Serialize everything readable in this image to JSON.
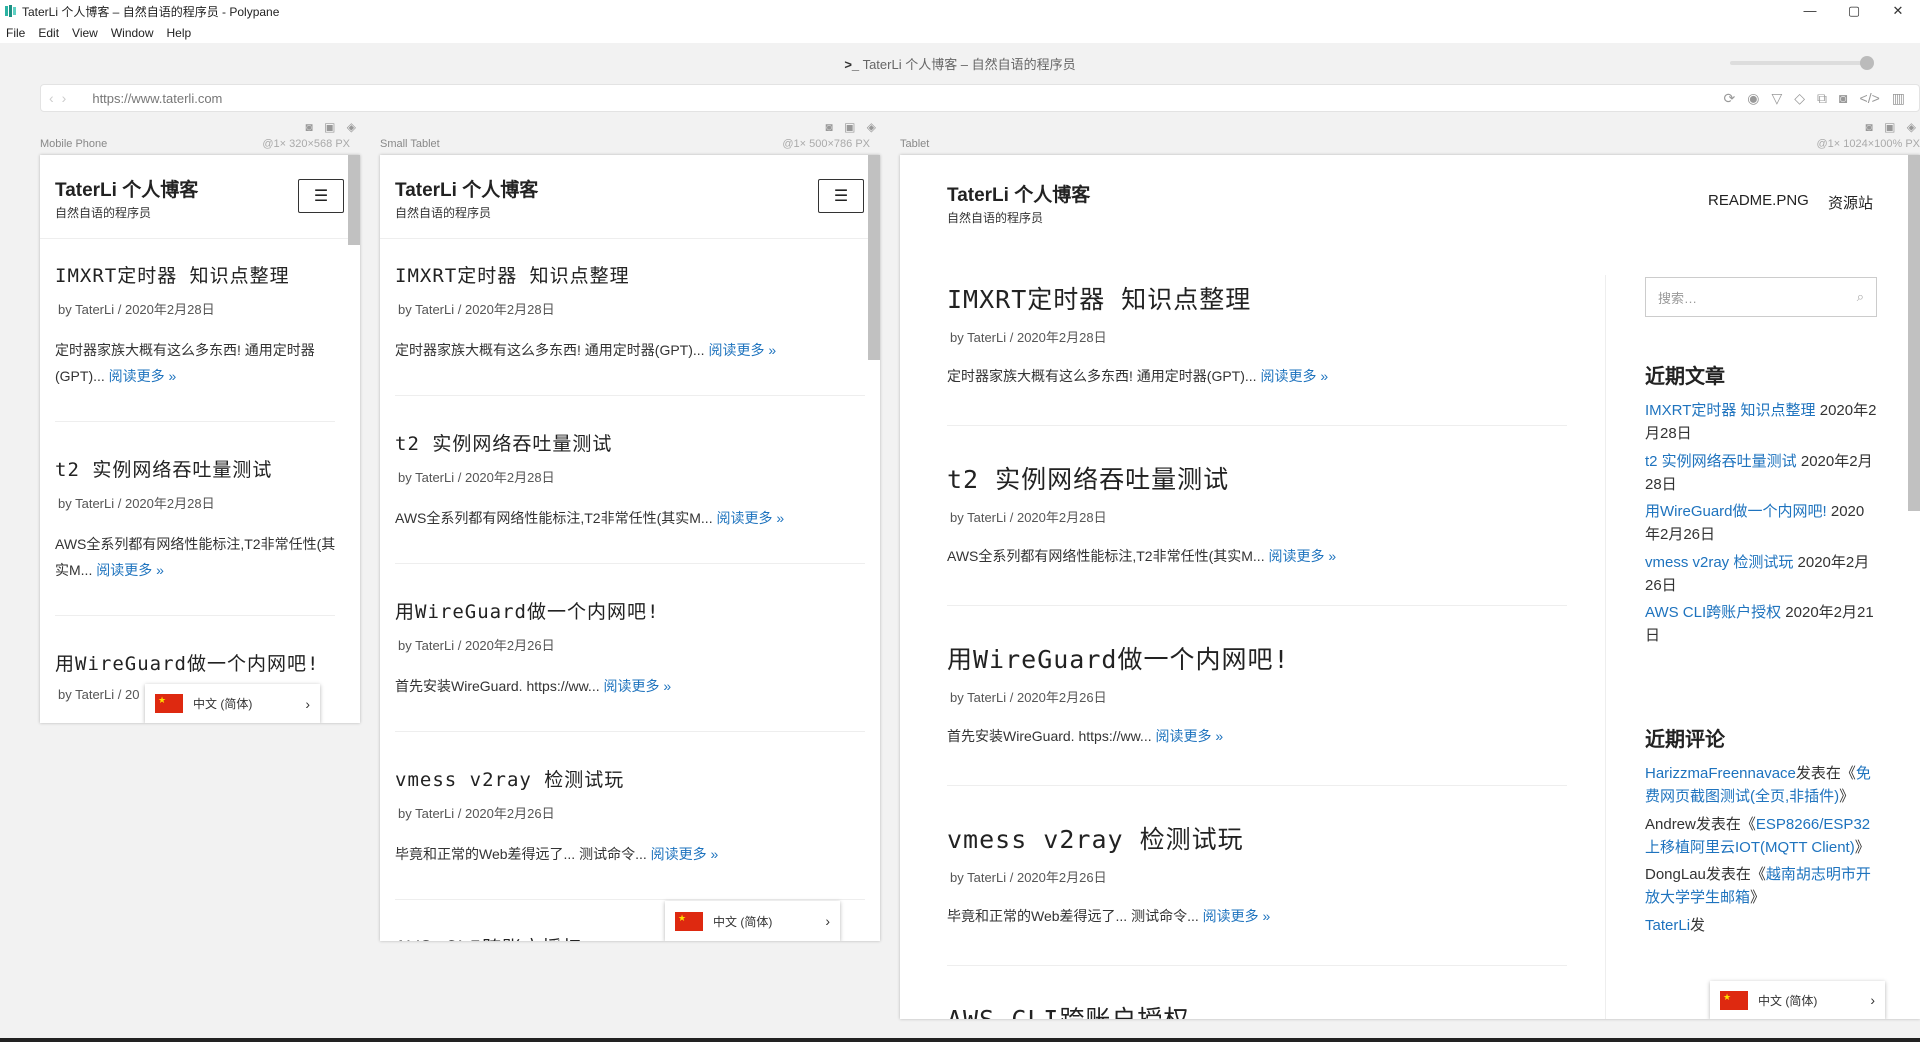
{
  "window": {
    "title": "TaterLi 个人博客 – 自然自语的程序员 - Polypane",
    "controls": [
      "—",
      "▢",
      "✕"
    ]
  },
  "menu": [
    "File",
    "Edit",
    "View",
    "Window",
    "Help"
  ],
  "toolbar": {
    "title_prefix": ">_",
    "page_title": "TaterLi 个人博客 – 自然自语的程序员",
    "url": "https://www.taterli.com",
    "back": "‹",
    "forward": "›"
  },
  "site": {
    "title": "TaterLi 个人博客",
    "description": "自然自语的程序员",
    "nav": [
      "README.PNG",
      "资源站"
    ],
    "menu_icon": "☰",
    "posts": [
      {
        "title": "IMXRT定时器 知识点整理",
        "meta": "by TaterLi / 2020年2月28日",
        "excerpt_narrow": "定时器家族大概有这么多东西! 通用定时器(GPT)...",
        "excerpt": "定时器家族大概有这么多东西! 通用定时器(GPT)...",
        "more": "阅读更多 »"
      },
      {
        "title": "t2 实例网络吞吐量测试",
        "meta": "by TaterLi / 2020年2月28日",
        "excerpt_narrow": "AWS全系列都有网络性能标注,T2非常任性(其实M...",
        "excerpt": "AWS全系列都有网络性能标注,T2非常任性(其实M...",
        "more": "阅读更多 »"
      },
      {
        "title": "用WireGuard做一个内网吧!",
        "meta": "by TaterLi / 2020年2月26日",
        "meta_short": "by TaterLi / 20",
        "excerpt": "首先安装WireGuard. https://ww...",
        "more": "阅读更多 »"
      },
      {
        "title": "vmess v2ray 检测试玩",
        "meta": "by TaterLi / 2020年2月26日",
        "excerpt": "毕竟和正常的Web差得远了... 测试命令...",
        "more": "阅读更多 »"
      },
      {
        "title": "AWS CLI跨账户授权"
      }
    ],
    "lang_label": "中文 (简体)",
    "lang_chevron": "›"
  },
  "panes": [
    {
      "name": "Mobile Phone",
      "dims": "@1× 320×568 PX"
    },
    {
      "name": "Small Tablet",
      "dims": "@1× 500×786 PX"
    },
    {
      "name": "Tablet",
      "dims": "@1× 1024×100% PX"
    }
  ],
  "pane_icons": "◙ ▣ ◈",
  "sidebar": {
    "search_placeholder": "搜索…",
    "recent_posts_title": "近期文章",
    "recent_posts": [
      {
        "link": "IMXRT定时器 知识点整理",
        "date": " 2020年2月28日"
      },
      {
        "link": "t2 实例网络吞吐量测试",
        "date": " 2020年2月28日"
      },
      {
        "link": "用WireGuard做一个内网吧!",
        "date": " 2020年2月26日"
      },
      {
        "link": "vmess v2ray 检测试玩",
        "date": " 2020年2月26日"
      },
      {
        "link": "AWS CLI跨账户授权",
        "date": " 2020年2月21日"
      }
    ],
    "recent_comments_title": "近期评论",
    "recent_comments": [
      {
        "author": "HarizzmaFreennavace",
        "mid": "发表在《",
        "post": "免费网页截图测试(全页,非插件)",
        "end": "》"
      },
      {
        "author": "Andrew",
        "mid": "发表在《",
        "post": "ESP8266/ESP32上移植阿里云IOT(MQTT Client)",
        "end": "》"
      },
      {
        "author": "DongLau",
        "mid": "发表在《",
        "post": "越南胡志明市开放大学学生邮箱",
        "end": "》"
      },
      {
        "author": "TaterLi",
        "mid": "发",
        "post": "",
        "end": ""
      }
    ]
  }
}
